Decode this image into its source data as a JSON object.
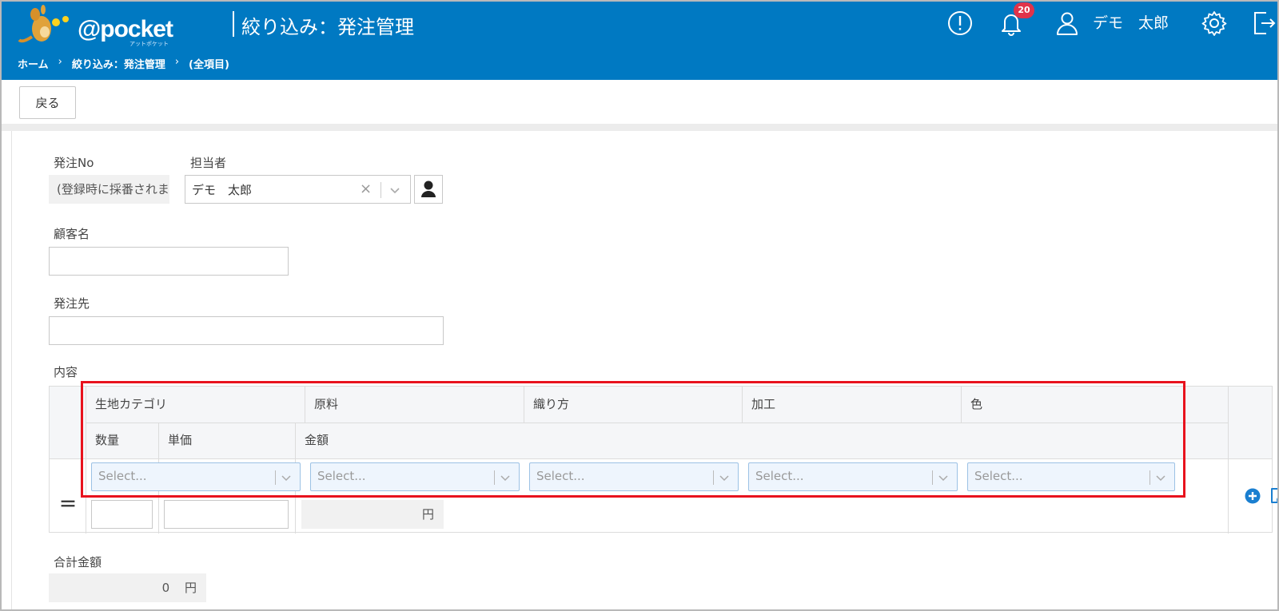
{
  "header": {
    "logo_text": "@pocket",
    "logo_sub": "アットポケット",
    "page_title": "絞り込み：発注管理",
    "breadcrumb": [
      "ホーム",
      "絞り込み：発注管理",
      "(全項目)"
    ],
    "notification_count": "20",
    "user_name": "デモ　太郎",
    "icons": [
      "alert-icon",
      "bell-icon",
      "user-icon",
      "gear-icon",
      "logout-icon"
    ]
  },
  "toolbar": {
    "back_label": "戻る"
  },
  "form": {
    "order_no_label": "発注No",
    "order_no_value": "(登録時に採番されます)",
    "tanto_label": "担当者",
    "tanto_value": "デモ　太郎",
    "customer_label": "顧客名",
    "supplier_label": "発注先",
    "content_label": "内容",
    "total_label": "合計金額",
    "total_value": "0",
    "total_unit": "円"
  },
  "table": {
    "headers_row1": [
      "生地カテゴリ",
      "原料",
      "織り方",
      "加工",
      "色"
    ],
    "headers_row2": [
      "数量",
      "単価",
      "金額"
    ],
    "select_placeholder": "Select...",
    "amount_unit": "円",
    "row_marker": "＝"
  },
  "colors": {
    "header_bg": "#0079c2",
    "highlight": "#e8121d",
    "badge": "#e0334a",
    "action_icon": "#1a7fd0"
  }
}
